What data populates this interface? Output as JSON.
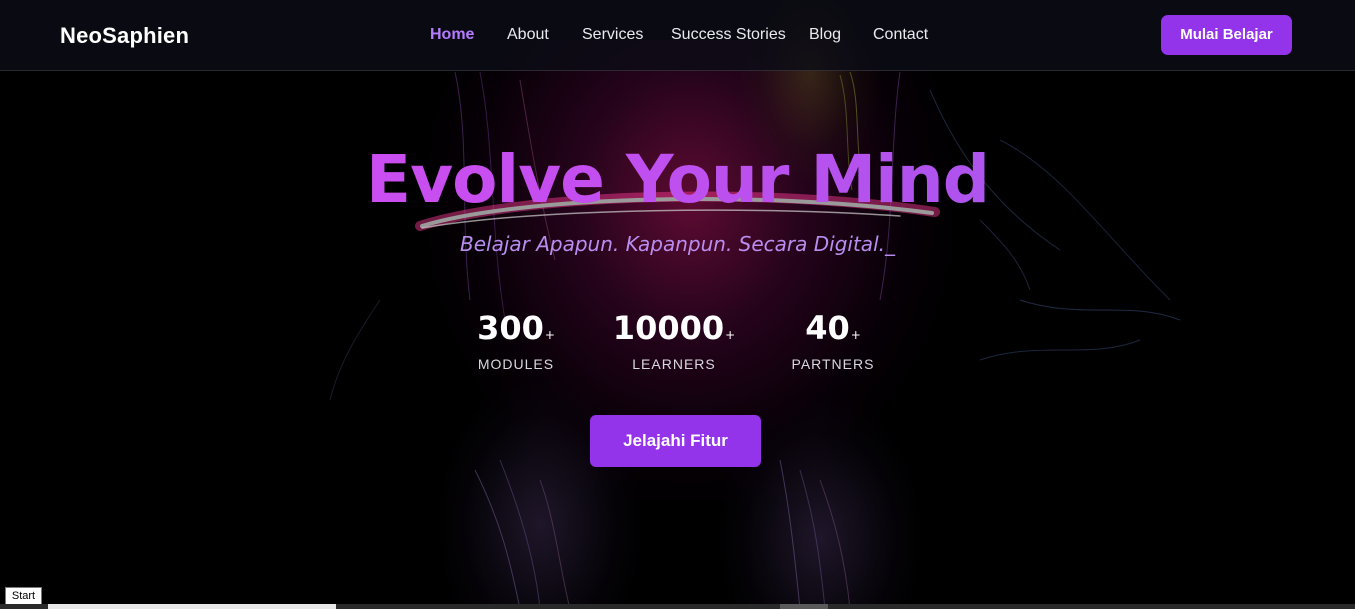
{
  "brand": {
    "name": "NeoSaphien"
  },
  "nav": {
    "items": [
      {
        "label": "Home",
        "active": true
      },
      {
        "label": "About",
        "active": false
      },
      {
        "label": "Services",
        "active": false
      },
      {
        "label": "Success Stories",
        "active": false
      },
      {
        "label": "Blog",
        "active": false
      },
      {
        "label": "Contact",
        "active": false
      }
    ],
    "cta_label": "Mulai Belajar"
  },
  "hero": {
    "title": "Evolve Your Mind",
    "subtitle": "Belajar Apapun. Kapanpun. Secara Digital._",
    "stats": [
      {
        "value": "300",
        "suffix": "+",
        "label": "MODULES"
      },
      {
        "value": "10000",
        "suffix": "+",
        "label": "LEARNERS"
      },
      {
        "value": "40",
        "suffix": "+",
        "label": "PARTNERS"
      }
    ],
    "cta_label": "Jelajahi Fitur"
  },
  "taskbar": {
    "start_label": "Start"
  },
  "colors": {
    "accent": "#9333ea",
    "nav_active": "#b57bff",
    "title_gradient_start": "#d24cf2",
    "title_gradient_end": "#a15cf0",
    "subtitle": "#b98df0",
    "background": "#000000"
  },
  "background_art": "neon-portrait-lines"
}
